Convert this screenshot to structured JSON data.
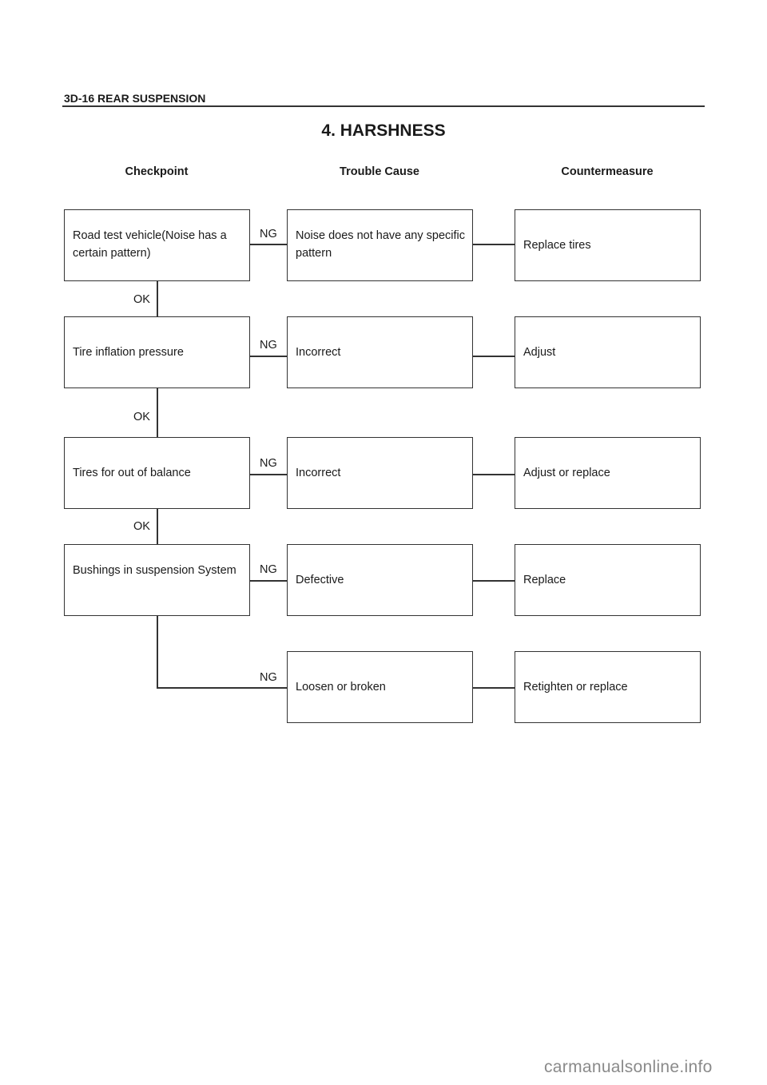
{
  "header": {
    "page_title": "3D-16  REAR SUSPENSION"
  },
  "section": {
    "title": "4.  HARSHNESS"
  },
  "columns": {
    "checkpoint": "Checkpoint",
    "trouble_cause": "Trouble Cause",
    "countermeasure": "Countermeasure"
  },
  "flow": {
    "rows": [
      {
        "checkpoint": "Road test vehicle(Noise has a certain pattern)",
        "result": "NG",
        "trouble_cause": "Noise does not have any specific pattern",
        "countermeasure": "Replace tires",
        "next": "OK"
      },
      {
        "checkpoint": "Tire inflation pressure",
        "result": "NG",
        "trouble_cause": "Incorrect",
        "countermeasure": "Adjust",
        "next": "OK"
      },
      {
        "checkpoint": "Tires for out of balance",
        "result": "NG",
        "trouble_cause": "Incorrect",
        "countermeasure": "Adjust or replace",
        "next": "OK"
      },
      {
        "checkpoint": "Bushings in suspension System",
        "result": "NG",
        "trouble_cause": "Defective",
        "countermeasure": "Replace"
      },
      {
        "result": "NG",
        "trouble_cause": "Loosen or broken",
        "countermeasure": "Retighten or replace"
      }
    ]
  },
  "watermark": "carmanualsonline.info"
}
